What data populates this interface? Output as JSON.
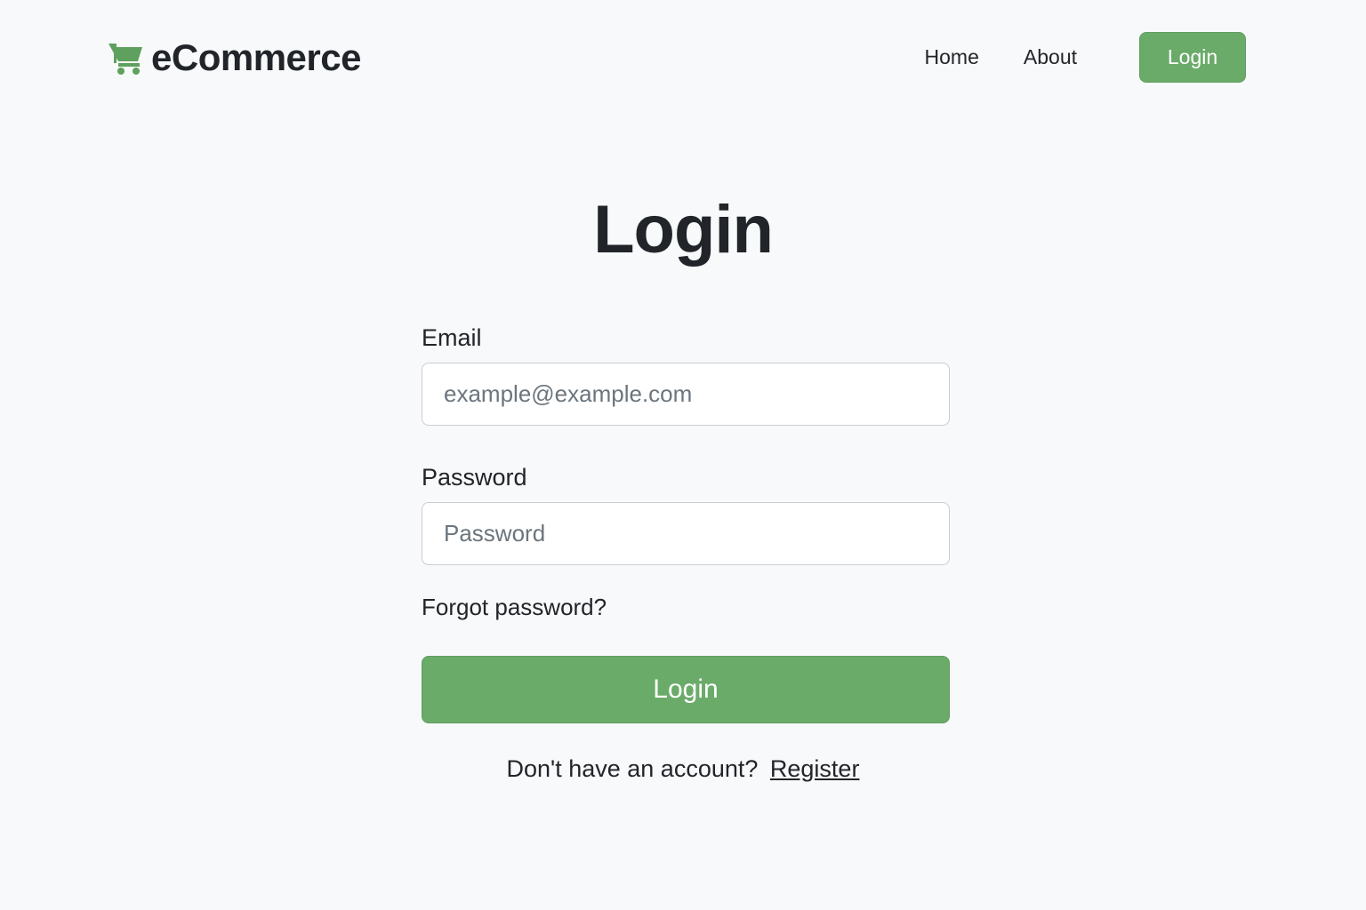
{
  "brand": {
    "name": "eCommerce",
    "icon": "shopping-cart-icon",
    "icon_color": "#5ea15e"
  },
  "nav": {
    "home_label": "Home",
    "about_label": "About",
    "login_label": "Login"
  },
  "page": {
    "title": "Login"
  },
  "form": {
    "email_label": "Email",
    "email_placeholder": "example@example.com",
    "email_value": "",
    "password_label": "Password",
    "password_placeholder": "Password",
    "password_value": "",
    "forgot_label": "Forgot password?",
    "submit_label": "Login"
  },
  "footer": {
    "prompt": "Don't have an account?",
    "register_label": "Register"
  },
  "colors": {
    "accent": "#6aab6a",
    "background": "#f8f9fa",
    "text": "#212529"
  }
}
